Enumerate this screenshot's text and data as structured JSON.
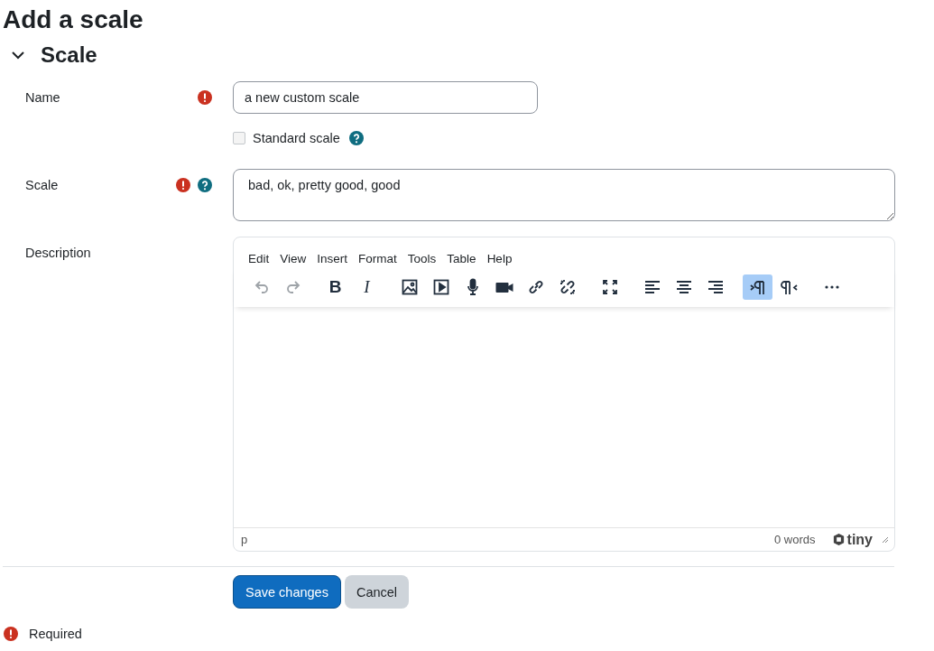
{
  "page_title": "Add a scale",
  "section": {
    "title": "Scale",
    "expanded": true
  },
  "name_field": {
    "label": "Name",
    "required": true,
    "value": "a new custom scale"
  },
  "standard_scale": {
    "label": "Standard scale",
    "checked": false,
    "help": true
  },
  "scale_field": {
    "label": "Scale",
    "required": true,
    "help": true,
    "value": "bad, ok, pretty good, good"
  },
  "description": {
    "label": "Description",
    "menu": [
      "Edit",
      "View",
      "Insert",
      "Format",
      "Tools",
      "Table",
      "Help"
    ],
    "toolbar_groups": [
      [
        {
          "kind": "undo",
          "disabled": true
        },
        {
          "kind": "redo",
          "disabled": true
        }
      ],
      [
        {
          "kind": "bold",
          "label": "B"
        },
        {
          "kind": "italic",
          "label": "I"
        }
      ],
      [
        {
          "kind": "image"
        },
        {
          "kind": "media"
        },
        {
          "kind": "mic"
        },
        {
          "kind": "video"
        },
        {
          "kind": "link"
        },
        {
          "kind": "unlink"
        }
      ],
      [
        {
          "kind": "fullscreen"
        }
      ],
      [
        {
          "kind": "align-left"
        },
        {
          "kind": "align-center"
        },
        {
          "kind": "align-right"
        }
      ],
      [
        {
          "kind": "ltr",
          "selected": true
        },
        {
          "kind": "rtl",
          "selected": false
        }
      ],
      [
        {
          "kind": "more"
        }
      ]
    ],
    "path": "p",
    "word_count": "0 words",
    "brand": "tiny"
  },
  "buttons": [
    {
      "label": "Save changes",
      "kind": "primary"
    },
    {
      "label": "Cancel",
      "kind": "secondary"
    }
  ],
  "required_note": "Required"
}
